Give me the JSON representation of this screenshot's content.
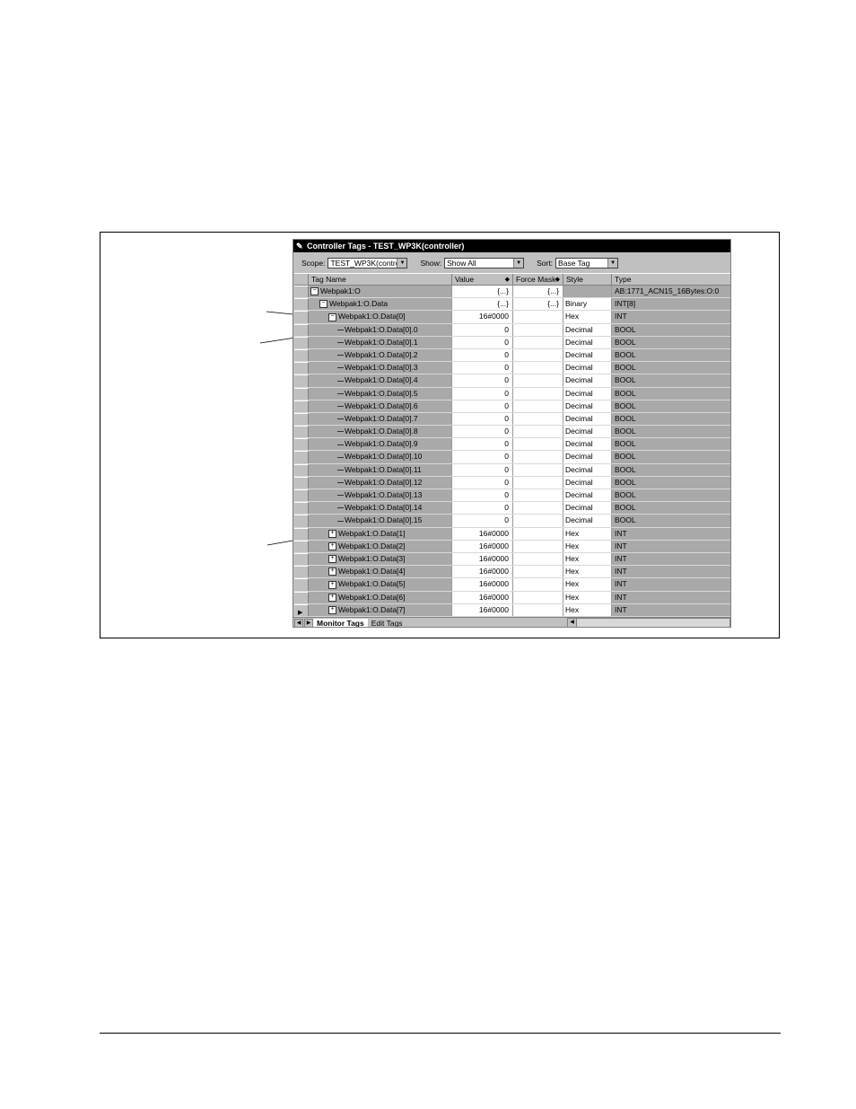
{
  "window": {
    "title": "Controller Tags - TEST_WP3K(controller)"
  },
  "toolbar": {
    "scope_label": "Scope:",
    "scope_value": "TEST_WP3K(contro",
    "show_label": "Show:",
    "show_value": "Show All",
    "sort_label": "Sort:",
    "sort_value": "Base Tag"
  },
  "columns": {
    "tag_name": "Tag Name",
    "value": "Value",
    "force_mask": "Force Mask",
    "style": "Style",
    "type": "Type"
  },
  "rows": [
    {
      "indent": 0,
      "node": "minus",
      "name": "Webpak1:O",
      "value": "{...}",
      "force": "{...}",
      "style": "",
      "type": "AB:1771_ACN15_16Bytes:O:0"
    },
    {
      "indent": 1,
      "node": "minus",
      "name": "Webpak1:O.Data",
      "value": "{...}",
      "force": "{...}",
      "style": "Binary",
      "type": "INT[8]"
    },
    {
      "indent": 2,
      "node": "minus",
      "name": "Webpak1:O.Data[0]",
      "value": "16#0000",
      "force": "",
      "style": "Hex",
      "type": "INT"
    },
    {
      "indent": 3,
      "node": "leaf",
      "name": "Webpak1:O.Data[0].0",
      "value": "0",
      "force": "",
      "style": "Decimal",
      "type": "BOOL"
    },
    {
      "indent": 3,
      "node": "leaf",
      "name": "Webpak1:O.Data[0].1",
      "value": "0",
      "force": "",
      "style": "Decimal",
      "type": "BOOL"
    },
    {
      "indent": 3,
      "node": "leaf",
      "name": "Webpak1:O.Data[0].2",
      "value": "0",
      "force": "",
      "style": "Decimal",
      "type": "BOOL"
    },
    {
      "indent": 3,
      "node": "leaf",
      "name": "Webpak1:O.Data[0].3",
      "value": "0",
      "force": "",
      "style": "Decimal",
      "type": "BOOL"
    },
    {
      "indent": 3,
      "node": "leaf",
      "name": "Webpak1:O.Data[0].4",
      "value": "0",
      "force": "",
      "style": "Decimal",
      "type": "BOOL"
    },
    {
      "indent": 3,
      "node": "leaf",
      "name": "Webpak1:O.Data[0].5",
      "value": "0",
      "force": "",
      "style": "Decimal",
      "type": "BOOL"
    },
    {
      "indent": 3,
      "node": "leaf",
      "name": "Webpak1:O.Data[0].6",
      "value": "0",
      "force": "",
      "style": "Decimal",
      "type": "BOOL"
    },
    {
      "indent": 3,
      "node": "leaf",
      "name": "Webpak1:O.Data[0].7",
      "value": "0",
      "force": "",
      "style": "Decimal",
      "type": "BOOL"
    },
    {
      "indent": 3,
      "node": "leaf",
      "name": "Webpak1:O.Data[0].8",
      "value": "0",
      "force": "",
      "style": "Decimal",
      "type": "BOOL"
    },
    {
      "indent": 3,
      "node": "leaf",
      "name": "Webpak1:O.Data[0].9",
      "value": "0",
      "force": "",
      "style": "Decimal",
      "type": "BOOL"
    },
    {
      "indent": 3,
      "node": "leaf",
      "name": "Webpak1:O.Data[0].10",
      "value": "0",
      "force": "",
      "style": "Decimal",
      "type": "BOOL"
    },
    {
      "indent": 3,
      "node": "leaf",
      "name": "Webpak1:O.Data[0].11",
      "value": "0",
      "force": "",
      "style": "Decimal",
      "type": "BOOL"
    },
    {
      "indent": 3,
      "node": "leaf",
      "name": "Webpak1:O.Data[0].12",
      "value": "0",
      "force": "",
      "style": "Decimal",
      "type": "BOOL"
    },
    {
      "indent": 3,
      "node": "leaf",
      "name": "Webpak1:O.Data[0].13",
      "value": "0",
      "force": "",
      "style": "Decimal",
      "type": "BOOL"
    },
    {
      "indent": 3,
      "node": "leaf",
      "name": "Webpak1:O.Data[0].14",
      "value": "0",
      "force": "",
      "style": "Decimal",
      "type": "BOOL"
    },
    {
      "indent": 3,
      "node": "leaf",
      "name": "Webpak1:O.Data[0].15",
      "value": "0",
      "force": "",
      "style": "Decimal",
      "type": "BOOL"
    },
    {
      "indent": 2,
      "node": "plus",
      "name": "Webpak1:O.Data[1]",
      "value": "16#0000",
      "force": "",
      "style": "Hex",
      "type": "INT"
    },
    {
      "indent": 2,
      "node": "plus",
      "name": "Webpak1:O.Data[2]",
      "value": "16#0000",
      "force": "",
      "style": "Hex",
      "type": "INT"
    },
    {
      "indent": 2,
      "node": "plus",
      "name": "Webpak1:O.Data[3]",
      "value": "16#0000",
      "force": "",
      "style": "Hex",
      "type": "INT"
    },
    {
      "indent": 2,
      "node": "plus",
      "name": "Webpak1:O.Data[4]",
      "value": "16#0000",
      "force": "",
      "style": "Hex",
      "type": "INT"
    },
    {
      "indent": 2,
      "node": "plus",
      "name": "Webpak1:O.Data[5]",
      "value": "16#0000",
      "force": "",
      "style": "Hex",
      "type": "INT"
    },
    {
      "indent": 2,
      "node": "plus",
      "name": "Webpak1:O.Data[6]",
      "value": "16#0000",
      "force": "",
      "style": "Hex",
      "type": "INT"
    },
    {
      "indent": 2,
      "node": "plus",
      "name": "Webpak1:O.Data[7]",
      "value": "16#0000",
      "force": "",
      "style": "Hex",
      "type": "INT"
    }
  ],
  "tabs": {
    "monitor": "Monitor Tags",
    "edit": "Edit Tags"
  },
  "icons": {
    "title": "pencil-icon",
    "dropdown": "chevron-down-icon",
    "current_row": "play-arrow-icon"
  }
}
